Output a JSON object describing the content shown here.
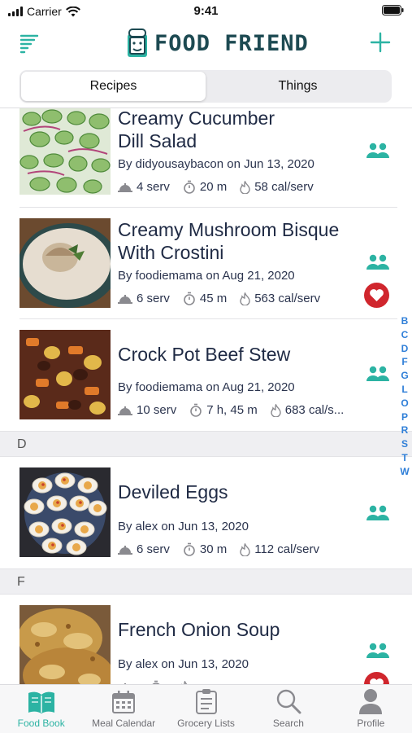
{
  "status_bar": {
    "carrier": "Carrier",
    "time": "9:41"
  },
  "header": {
    "brand": "FOOD FRIEND",
    "menu_icon": "sort-lines-icon",
    "add_icon": "plus-icon"
  },
  "segments": [
    {
      "label": "Recipes",
      "active": true
    },
    {
      "label": "Things",
      "active": false
    }
  ],
  "recipes": [
    {
      "title_line1": "Creamy Cucumber",
      "title_line2": "Dill Salad",
      "byline": "By didyousaybacon on Jun 13, 2020",
      "servings": "4 serv",
      "time": "20 m",
      "calories": "58 cal/serv",
      "shared": true,
      "favorite": false
    },
    {
      "title_line1": "Creamy Mushroom Bisque",
      "title_line2": "With Crostini",
      "byline": "By foodiemama on Aug 21, 2020",
      "servings": "6 serv",
      "time": "45 m",
      "calories": "563 cal/serv",
      "shared": true,
      "favorite": true
    },
    {
      "title_line1": "Crock Pot Beef Stew",
      "title_line2": "",
      "byline": "By foodiemama on Aug 21, 2020",
      "servings": "10 serv",
      "time": "7 h, 45 m",
      "calories": "683 cal/s...",
      "shared": true,
      "favorite": false
    },
    {
      "title_line1": "Deviled Eggs",
      "title_line2": "",
      "byline": "By alex on Jun 13, 2020",
      "servings": "6 serv",
      "time": "30 m",
      "calories": "112 cal/serv",
      "shared": true,
      "favorite": false
    },
    {
      "title_line1": "French Onion Soup",
      "title_line2": "",
      "byline": "By alex on Jun 13, 2020",
      "servings": "",
      "time": "",
      "calories": "",
      "shared": true,
      "favorite": true
    }
  ],
  "sections": {
    "d": "D",
    "f": "F"
  },
  "index_letters": [
    "B",
    "C",
    "D",
    "F",
    "G",
    "L",
    "O",
    "P",
    "R",
    "S",
    "T",
    "W"
  ],
  "tabs": [
    {
      "label": "Food Book",
      "icon": "open-book-icon",
      "active": true
    },
    {
      "label": "Meal Calendar",
      "icon": "calendar-icon",
      "active": false
    },
    {
      "label": "Grocery Lists",
      "icon": "clipboard-icon",
      "active": false
    },
    {
      "label": "Search",
      "icon": "magnifier-icon",
      "active": false
    },
    {
      "label": "Profile",
      "icon": "person-icon",
      "active": false
    }
  ],
  "colors": {
    "accent": "#2cb3a3",
    "brand_text": "#1d4a52",
    "heart": "#d0262d",
    "index": "#2f7fd8"
  }
}
